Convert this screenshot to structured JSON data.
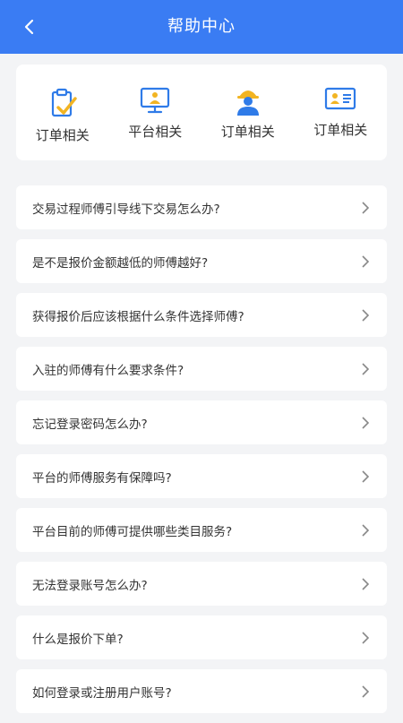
{
  "header": {
    "title": "帮助中心",
    "back_icon": "chevron-left-icon",
    "bg_color": "#3a7cf3"
  },
  "categories": [
    {
      "label": "订单相关",
      "icon": "clipboard-check-icon"
    },
    {
      "label": "平台相关",
      "icon": "monitor-person-icon"
    },
    {
      "label": "订单相关",
      "icon": "worker-helmet-icon"
    },
    {
      "label": "订单相关",
      "icon": "id-card-icon"
    }
  ],
  "faq": [
    "交易过程师傅引导线下交易怎么办?",
    "是不是报价金额越低的师傅越好?",
    "获得报价后应该根据什么条件选择师傅?",
    "入驻的师傅有什么要求条件?",
    "忘记登录密码怎么办?",
    "平台的师傅服务有保障吗?",
    "平台目前的师傅可提供哪些类目服务?",
    "无法登录账号怎么办?",
    "什么是报价下单?",
    "如何登录或注册用户账号?"
  ]
}
